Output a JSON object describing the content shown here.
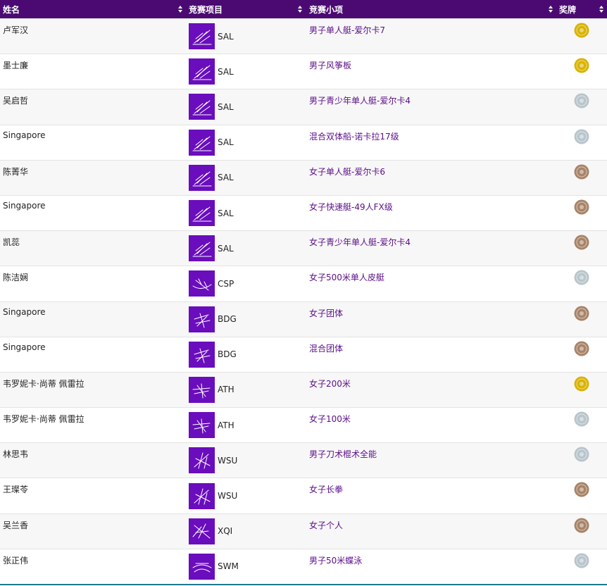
{
  "header": {
    "name": "姓名",
    "sport": "竞赛项目",
    "event": "竞赛小项",
    "medal": "奖牌"
  },
  "medal_colors": {
    "gold": "#d9b300",
    "silver": "#b8c5cc",
    "bronze": "#a88468"
  },
  "rows": [
    {
      "name": "卢军汉",
      "sport_code": "SAL",
      "sport_icon": "sailing-icon",
      "event": "男子单人艇-爱尔卡7",
      "medal": "gold"
    },
    {
      "name": "墨士廉",
      "sport_code": "SAL",
      "sport_icon": "sailing-icon",
      "event": "男子风筝板",
      "medal": "gold"
    },
    {
      "name": "吴启哲",
      "sport_code": "SAL",
      "sport_icon": "sailing-icon",
      "event": "男子青少年单人艇-爱尔卡4",
      "medal": "silver"
    },
    {
      "name": "Singapore",
      "sport_code": "SAL",
      "sport_icon": "sailing-icon",
      "event": "混合双体船-诺卡拉17级",
      "medal": "silver"
    },
    {
      "name": "陈菁华",
      "sport_code": "SAL",
      "sport_icon": "sailing-icon",
      "event": "女子单人艇-爱尔卡6",
      "medal": "bronze"
    },
    {
      "name": "Singapore",
      "sport_code": "SAL",
      "sport_icon": "sailing-icon",
      "event": "女子快速艇-49人FX级",
      "medal": "bronze"
    },
    {
      "name": "凯蕊",
      "sport_code": "SAL",
      "sport_icon": "sailing-icon",
      "event": "女子青少年单人艇-爱尔卡4",
      "medal": "bronze"
    },
    {
      "name": "陈洁娴",
      "sport_code": "CSP",
      "sport_icon": "canoe-sprint-icon",
      "event": "女子500米单人皮艇",
      "medal": "silver"
    },
    {
      "name": "Singapore",
      "sport_code": "BDG",
      "sport_icon": "badminton-icon",
      "event": "女子团体",
      "medal": "bronze"
    },
    {
      "name": "Singapore",
      "sport_code": "BDG",
      "sport_icon": "badminton-icon",
      "event": "混合团体",
      "medal": "bronze"
    },
    {
      "name": "韦罗妮卡·尚蒂 佩雷拉",
      "sport_code": "ATH",
      "sport_icon": "athletics-icon",
      "event": "女子200米",
      "medal": "gold"
    },
    {
      "name": "韦罗妮卡·尚蒂 佩雷拉",
      "sport_code": "ATH",
      "sport_icon": "athletics-icon",
      "event": "女子100米",
      "medal": "silver"
    },
    {
      "name": "林思韦",
      "sport_code": "WSU",
      "sport_icon": "wushu-icon",
      "event": "男子刀术棍术全能",
      "medal": "silver"
    },
    {
      "name": "王璨苓",
      "sport_code": "WSU",
      "sport_icon": "wushu-icon",
      "event": "女子长拳",
      "medal": "bronze"
    },
    {
      "name": "吴兰香",
      "sport_code": "XQI",
      "sport_icon": "xiangqi-icon",
      "event": "女子个人",
      "medal": "bronze"
    },
    {
      "name": "张正伟",
      "sport_code": "SWM",
      "sport_icon": "swimming-icon",
      "event": "男子50米蝶泳",
      "medal": "silver"
    }
  ]
}
